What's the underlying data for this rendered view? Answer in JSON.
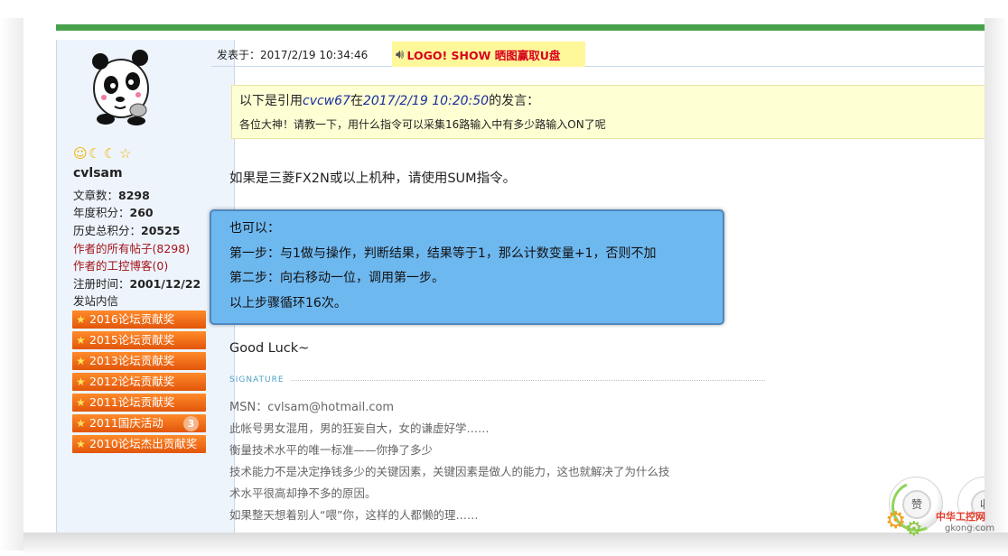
{
  "post": {
    "date_label": "发表于：2017/2/19 10:34:46",
    "promo_text": "LOGO! SHOW 晒图赢取U盘"
  },
  "user": {
    "name": "cvlsam",
    "stats": {
      "articles_label": "文章数：",
      "articles": "8298",
      "year_points_label": "年度积分：",
      "year_points": "260",
      "total_points_label": "历史总积分：",
      "total_points": "20525",
      "all_posts_link": "作者的所有帖子(8298)",
      "blog_link": "作者的工控博客(0)",
      "register_label": "注册时间：",
      "register_date": "2001/12/22",
      "message_link": "发站内信"
    },
    "badges": [
      {
        "label": "2016论坛贡献奖"
      },
      {
        "label": "2015论坛贡献奖"
      },
      {
        "label": "2013论坛贡献奖"
      },
      {
        "label": "2012论坛贡献奖"
      },
      {
        "label": "2011论坛贡献奖"
      },
      {
        "label": "2011国庆活动",
        "count": "3"
      },
      {
        "label": "2010论坛杰出贡献奖"
      }
    ]
  },
  "quote": {
    "prefix": "以下是引用",
    "author": "cvcw67",
    "at": "在",
    "time": "2017/2/19 10:20:50",
    "suffix": "的发言：",
    "text": "各位大神！请教一下，用什么指令可以采集16路输入中有多少路输入ON了呢"
  },
  "reply": {
    "line1": "如果是三菱FX2N或以上机种，请使用SUM指令。",
    "box": [
      "也可以：",
      "第一步：与1做与操作，判断结果，结果等于1，那么计数变量+1，否则不加",
      "第二步：向右移动一位，调用第一步。",
      "以上步骤循环16次。"
    ],
    "closing": "Good Luck~"
  },
  "signature": {
    "label": "SIGNATURE",
    "lines": [
      "MSN：cvlsam@hotmail.com",
      "此帐号男女混用，男的狂妄自大，女的谦虚好学……",
      "衡量技术水平的唯一标准——你挣了多少",
      "技术能力不是决定挣钱多少的关键因素，关键因素是做人的能力，这也就解决了为什么技",
      "术水平很高却挣不多的原因。",
      "如果整天想着别人“喂”你，这样的人都懒的理……"
    ]
  },
  "float_buttons": {
    "like": "赞",
    "second": "收"
  },
  "watermark": {
    "cn": "中华工控网",
    "en": "gkong.com"
  },
  "colors": {
    "top_bar": "#47a14b",
    "badge": "#f27020",
    "quote_bg": "#ffffd4",
    "box_bg": "#6eb8f0",
    "link_red": "#a3141a"
  },
  "icons": {
    "rank": [
      "smiley-icon",
      "moon-icon",
      "moon-icon",
      "star-icon"
    ],
    "promo": "speaker-icon",
    "badge": "star-icon"
  }
}
